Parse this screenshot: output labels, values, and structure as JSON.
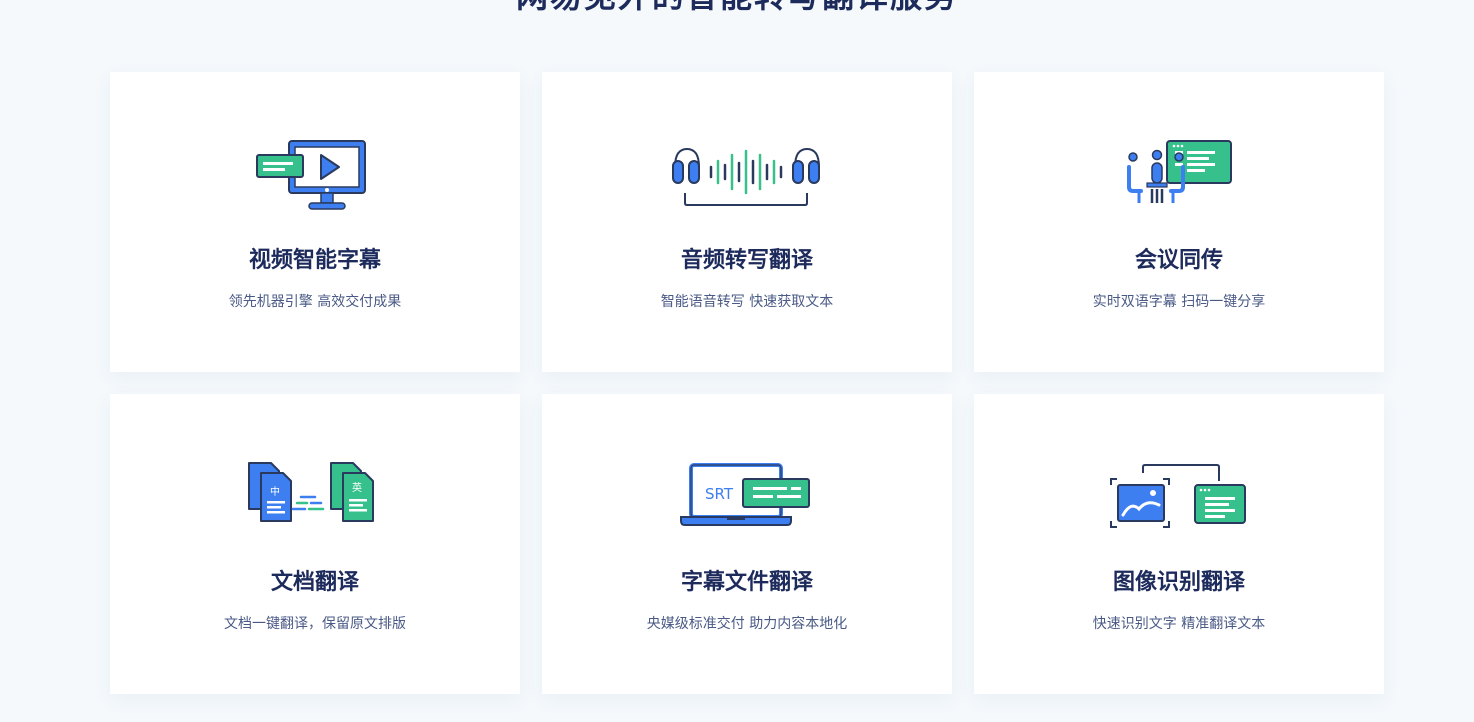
{
  "section": {
    "title": "网易见外的智能转写翻译服务"
  },
  "cards": [
    {
      "title": "视频智能字幕",
      "desc": "领先机器引擎 高效交付成果",
      "icon": "video-monitor-icon"
    },
    {
      "title": "音频转写翻译",
      "desc": "智能语音转写 快速获取文本",
      "icon": "audio-waveform-icon"
    },
    {
      "title": "会议同传",
      "desc": "实时双语字幕 扫码一键分享",
      "icon": "meeting-screen-icon"
    },
    {
      "title": "文档翻译",
      "desc": "文档一键翻译，保留原文排版",
      "icon": "document-translate-icon",
      "icon_labels": {
        "source": "中",
        "target": "英"
      }
    },
    {
      "title": "字幕文件翻译",
      "desc": "央媒级标准交付 助力内容本地化",
      "icon": "subtitle-laptop-icon",
      "icon_labels": {
        "badge": "SRT"
      }
    },
    {
      "title": "图像识别翻译",
      "desc": "快速识别文字 精准翻译文本",
      "icon": "image-ocr-icon"
    }
  ],
  "colors": {
    "blue": "#3d7ef0",
    "green": "#36c08c",
    "navy": "#1d2a5c",
    "outline": "#2a3a5e"
  }
}
